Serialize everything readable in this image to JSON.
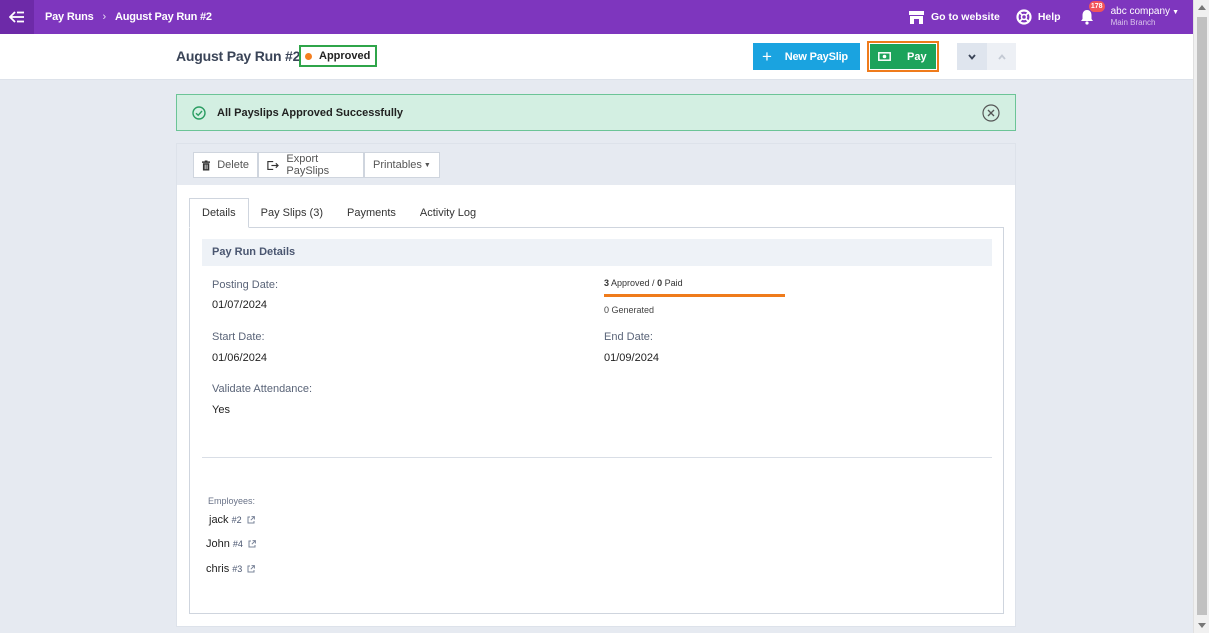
{
  "topbar": {
    "breadcrumb": [
      "Pay Runs",
      "August Pay Run #2"
    ],
    "go_to_website": "Go to website",
    "help": "Help",
    "notifications_count": "178",
    "company": "abc company",
    "branch": "Main Branch"
  },
  "header": {
    "title": "August Pay Run #2",
    "status": "Approved",
    "new_payslip_label": "New PaySlip",
    "pay_label": "Pay"
  },
  "alert": {
    "message": "All Payslips Approved Successfully"
  },
  "toolbar": {
    "delete_label": "Delete",
    "export_label": "Export PaySlips",
    "printables_label": "Printables"
  },
  "tabs": [
    {
      "label": "Details",
      "active": true
    },
    {
      "label": "Pay Slips (3)",
      "active": false
    },
    {
      "label": "Payments",
      "active": false
    },
    {
      "label": "Activity Log",
      "active": false
    }
  ],
  "details": {
    "section_title": "Pay Run Details",
    "posting_date_label": "Posting Date:",
    "posting_date": "01/07/2024",
    "start_date_label": "Start Date:",
    "start_date": "01/06/2024",
    "end_date_label": "End Date:",
    "end_date": "01/09/2024",
    "validate_attendance_label": "Validate Attendance:",
    "validate_attendance": "Yes",
    "progress": {
      "approved_count": "3",
      "approved_text": " Approved / ",
      "paid_count": "0",
      "paid_text": " Paid",
      "generated_text": "0 Generated",
      "fill_fraction": 1.0
    }
  },
  "employees": {
    "label": "Employees:",
    "list": [
      {
        "name": "jack",
        "number": "#2"
      },
      {
        "name": "John",
        "number": "#4"
      },
      {
        "name": "chris",
        "number": "#3"
      }
    ]
  },
  "colors": {
    "topbar": "#7e36be",
    "new_payslip": "#1aa3e0",
    "pay": "#1ca35b",
    "highlight_orange": "#ef7b1b",
    "approved_border": "#2fa54a",
    "alert_bg": "#d3efe2"
  },
  "icons": {
    "menu": "menu-back-icon",
    "store": "store-icon",
    "help": "lifebuoy-icon",
    "bell": "bell-icon",
    "check": "check-circle-icon",
    "close": "close-circle-icon",
    "trash": "trash-icon",
    "export": "export-icon",
    "cash": "cash-icon",
    "external": "external-link-icon"
  }
}
